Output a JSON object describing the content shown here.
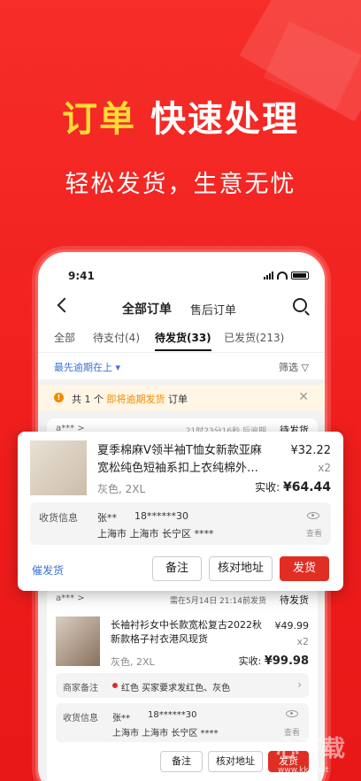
{
  "banner": {
    "title_yellow": "订单",
    "title_white": "快速处理",
    "subtitle": "轻松发货，生意无忧"
  },
  "status": {
    "time": "9:41"
  },
  "nav": {
    "back_icon": "chevron-left-icon",
    "title": "全部订单",
    "aftersale": "售后订单",
    "search_icon": "search-icon"
  },
  "tabs": [
    {
      "label": "全部"
    },
    {
      "label": "待支付(4)"
    },
    {
      "label": "待发货(33)"
    },
    {
      "label": "已发货(213)"
    }
  ],
  "filter": {
    "sort": "最先逾期在上 ▾",
    "filter": "筛选 ▽"
  },
  "notice": {
    "pre": "共 1 个 ",
    "highlight": "即将逾期发货",
    "post": " 订单",
    "close": "✕"
  },
  "card1": {
    "user": "a*** >",
    "deadline": "21时23分16秒 后逾期",
    "status": "待发货"
  },
  "popup": {
    "product_name": "夏季棉麻V领半袖T恤女新款亚麻宽松纯色短袖系扣上衣纯棉外…",
    "price": "¥32.22",
    "qty": "x2",
    "sku": "灰色, 2XL",
    "paid_label": "实收: ",
    "paid_value": "¥64.44",
    "ship_label": "收货信息",
    "recipient": "张**",
    "phone": "18******30",
    "address": "上海市 上海市 长宁区 ****",
    "view": "查看",
    "urge": "催发货",
    "btn_note": "备注",
    "btn_check": "核对地址",
    "btn_ship": "发货"
  },
  "card2": {
    "user": "a*** >",
    "deadline": "需在5月14日 21:14前发货",
    "status": "待发货",
    "product_name": "长袖衬衫女中长款宽松复古2022秋新款格子衬衣港风现货",
    "price": "¥49.99",
    "qty": "x2",
    "sku": "灰色, 2XL",
    "paid_label": "实收: ",
    "paid_value": "¥99.98",
    "merchant_label": "商家备注",
    "merchant_note": "红色    买家要求发红色、灰色",
    "ship_label": "收货信息",
    "recipient": "张**",
    "phone": "18******30",
    "address": "上海市 上海市 长宁区 ****",
    "view": "查看",
    "btn_note": "备注",
    "btn_check": "核对地址",
    "btn_ship": "发货"
  },
  "watermark": {
    "mark": "心下载",
    "url": "www.kkx.net"
  }
}
